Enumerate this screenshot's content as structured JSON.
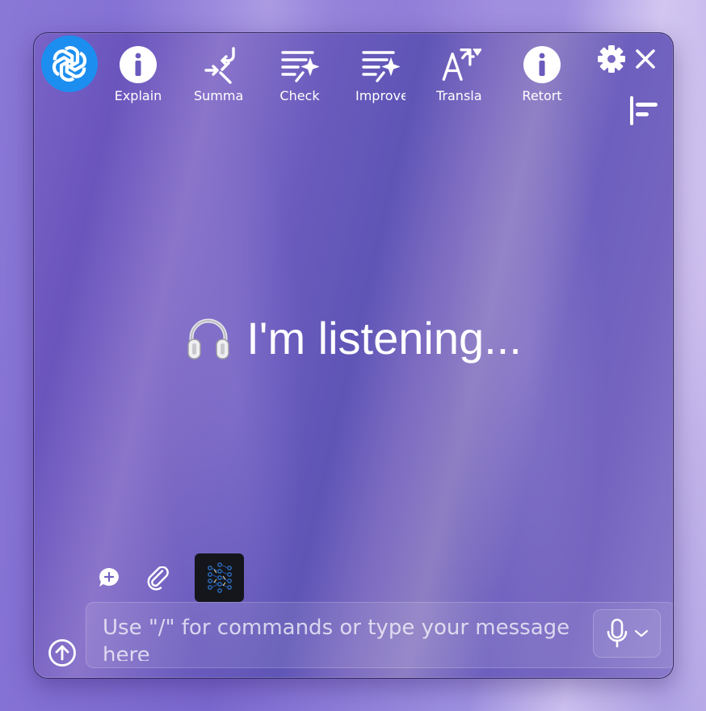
{
  "toolbar": {
    "tools": [
      {
        "label": "Explain",
        "icon": "info-icon"
      },
      {
        "label": "Summa",
        "icon": "compress-icon"
      },
      {
        "label": "Check",
        "icon": "text-sparkle-icon"
      },
      {
        "label": "Improve",
        "icon": "text-sparkle-icon"
      },
      {
        "label": "Transla",
        "icon": "translate-icon"
      },
      {
        "label": "Retort",
        "icon": "info-icon"
      }
    ]
  },
  "main": {
    "status_text": "I'm listening...",
    "status_emoji": "headphones-icon"
  },
  "composer": {
    "placeholder": "Use \"/\" for commands or type your message here"
  },
  "colors": {
    "logo_bg": "#1c8ef0",
    "window_bg": "#6a5bbd",
    "thumb_bg": "#15161b"
  }
}
